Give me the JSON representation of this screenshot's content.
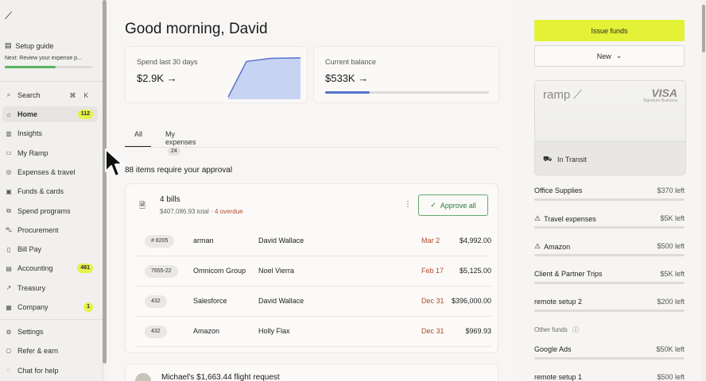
{
  "sidebar": {
    "setup_title": "Setup guide",
    "setup_subtitle": "Next: Review your expense p...",
    "setup_progress": 0.58,
    "search_label": "Search",
    "search_shortcut": "⌘ K",
    "items": [
      {
        "label": "Home",
        "badge": "112",
        "icon": "home-icon"
      },
      {
        "label": "Insights",
        "badge": "",
        "icon": "insights-icon"
      },
      {
        "label": "My Ramp",
        "badge": "",
        "icon": "wallet-icon"
      },
      {
        "label": "Expenses & travel",
        "badge": "",
        "icon": "expenses-icon"
      },
      {
        "label": "Funds & cards",
        "badge": "",
        "icon": "cards-icon"
      },
      {
        "label": "Spend programs",
        "badge": "",
        "icon": "programs-icon"
      },
      {
        "label": "Procurement",
        "badge": "",
        "icon": "cart-icon"
      },
      {
        "label": "Bill Pay",
        "badge": "",
        "icon": "bill-icon"
      },
      {
        "label": "Accounting",
        "badge": "461",
        "icon": "book-icon"
      },
      {
        "label": "Treasury",
        "badge": "",
        "icon": "trend-icon"
      },
      {
        "label": "Company",
        "badge": "1",
        "icon": "building-icon"
      }
    ],
    "bottom_items": [
      {
        "label": "Settings",
        "icon": "gear-icon"
      },
      {
        "label": "Refer & earn",
        "icon": "gift-icon"
      },
      {
        "label": "Chat for help",
        "icon": "chat-icon"
      }
    ]
  },
  "main": {
    "greeting": "Good morning, David",
    "spend_label": "Spend last 30 days",
    "spend_value": "$2.9K →",
    "balance_label": "Current balance",
    "balance_value": "$533K →",
    "balance_progress": 0.27,
    "spend_trend": [
      0.05,
      0.85,
      0.92,
      0.93
    ],
    "tabs": [
      {
        "label": "All",
        "count": ""
      },
      {
        "label": "My expenses",
        "count": "24"
      }
    ],
    "approvals_heading": "88 items require your approval",
    "bills": {
      "title": "4 bills",
      "total": "$407,086.93 total",
      "separator": " · ",
      "overdue": "4 overdue",
      "approve_label": "Approve all",
      "rows": [
        {
          "tag": "# 8205",
          "vendor": "arman",
          "person": "David Wallace",
          "date": "Mar 2",
          "amount": "$4,992.00"
        },
        {
          "tag": "7655-22",
          "vendor": "Omnicom Group",
          "person": "Noel Vierra",
          "date": "Feb 17",
          "amount": "$5,125.00"
        },
        {
          "tag": "432",
          "vendor": "Salesforce",
          "person": "David Wallace",
          "date": "Dec 31",
          "amount": "$396,000.00"
        },
        {
          "tag": "432",
          "vendor": "Amazon",
          "person": "Holly Flax",
          "date": "Dec 31",
          "amount": "$969.93"
        }
      ]
    },
    "flight_request": "Michael's $1,663.44 flight request"
  },
  "right": {
    "issue_funds": "Issue funds",
    "new_label": "New",
    "card_brand": "ramp",
    "card_network": "VISA",
    "card_network_sub": "Signature Business",
    "card_status": "In Transit",
    "funds": [
      {
        "name": "Office Supplies",
        "amount": "$370 left",
        "warn": false,
        "used": 0.3
      },
      {
        "name": "Travel expenses",
        "amount": "$5K left",
        "warn": true,
        "used": 0.9
      },
      {
        "name": "Amazon",
        "amount": "$500 left",
        "warn": true,
        "used": 0.85
      },
      {
        "name": "Client & Partner Trips",
        "amount": "$5K left",
        "warn": false,
        "used": 0.2
      },
      {
        "name": "remote setup 2",
        "amount": "$200 left",
        "warn": false,
        "used": 0.4
      }
    ],
    "other_funds_label": "Other funds",
    "other_funds": [
      {
        "name": "Google Ads",
        "amount": "$50K left"
      },
      {
        "name": "remote setup 1",
        "amount": "$500 left"
      }
    ]
  },
  "colors": {
    "accent_yellow": "#e3f137",
    "approve_green": "#2e7a3a",
    "overdue_red": "#b2482a",
    "chart_fill": "#c7d3f2",
    "chart_line": "#5774c9"
  }
}
